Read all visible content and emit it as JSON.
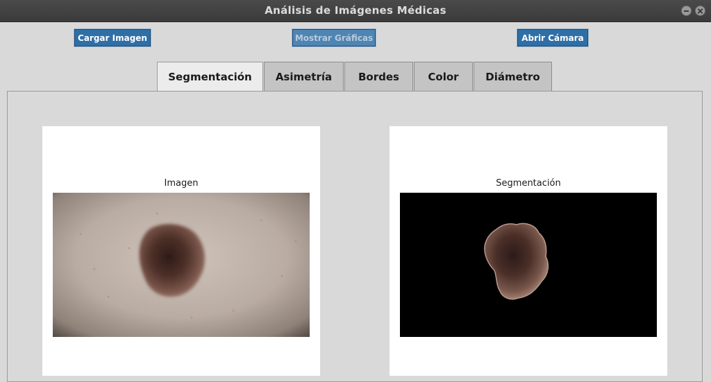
{
  "window": {
    "title": "Análisis de Imágenes Médicas"
  },
  "toolbar": {
    "load_label": "Cargar Imagen",
    "charts_label": "Mostrar Gráficas",
    "camera_label": "Abrir Cámara"
  },
  "tabs": [
    {
      "label": "Segmentación",
      "active": true
    },
    {
      "label": "Asimetría",
      "active": false
    },
    {
      "label": "Bordes",
      "active": false
    },
    {
      "label": "Color",
      "active": false
    },
    {
      "label": "Diámetro",
      "active": false
    }
  ],
  "panels": {
    "original": {
      "title": "Imagen"
    },
    "segmented": {
      "title": "Segmentación"
    }
  },
  "colors": {
    "button": "#2f6fa6",
    "button_disabled": "#4f85b3",
    "titlebar": "#3f3f3f",
    "background": "#d9d9d9",
    "lesion": "#5a3a30"
  }
}
